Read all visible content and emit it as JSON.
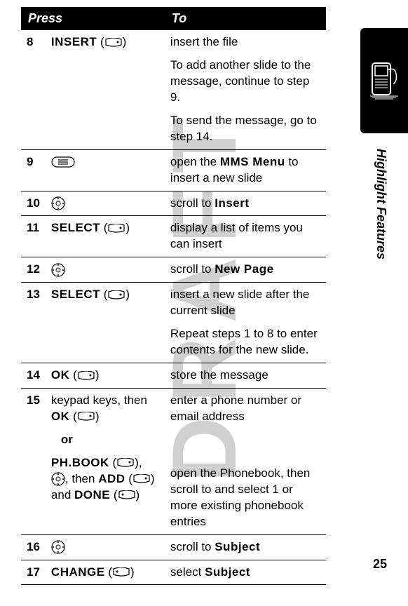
{
  "watermark": "DRAFT",
  "side_label": "Highlight Features",
  "page_number": "25",
  "header": {
    "press": "Press",
    "to": "To"
  },
  "rows": {
    "r8": {
      "num": "8",
      "press_label": "INSERT",
      "to1": "insert the file",
      "to2": "To add another slide to the message, continue to step 9.",
      "to3": "To send the message, go to step 14."
    },
    "r9": {
      "num": "9",
      "to_pre": "open the ",
      "to_bold": "MMS Menu",
      "to_post": " to insert a new slide"
    },
    "r10": {
      "num": "10",
      "to_pre": "scroll to ",
      "to_bold": "Insert"
    },
    "r11": {
      "num": "11",
      "press_label": "SELECT",
      "to": "display a list of items you can insert"
    },
    "r12": {
      "num": "12",
      "to_pre": "scroll to ",
      "to_bold": "New Page"
    },
    "r13": {
      "num": "13",
      "press_label": "SELECT",
      "to1": "insert a new slide after the current slide",
      "to2": "Repeat steps 1 to 8 to enter contents for the new slide."
    },
    "r14": {
      "num": "14",
      "press_label": "OK",
      "to": "store the message"
    },
    "r15": {
      "num": "15",
      "press_a_pre": "keypad keys, then ",
      "press_a_label": "OK",
      "or": "or",
      "press_b_label1": "PH.BOOK",
      "press_b_mid": ", then ",
      "press_b_label2": "ADD",
      "press_b_and": " and ",
      "press_b_label3": "DONE",
      "to_a": "enter a phone number or email address",
      "to_b": "open the Phonebook, then scroll to and select 1 or more existing phonebook entries"
    },
    "r16": {
      "num": "16",
      "to_pre": "scroll to ",
      "to_bold": "Subject"
    },
    "r17": {
      "num": "17",
      "press_label": "CHANGE",
      "to_pre": "select ",
      "to_bold": "Subject"
    }
  }
}
